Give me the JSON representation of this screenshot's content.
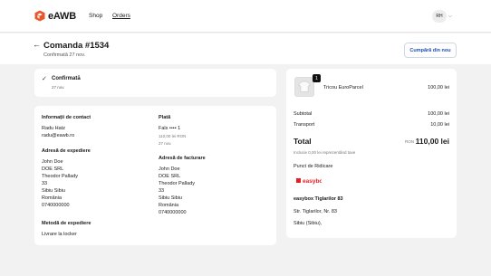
{
  "topbar": {
    "brand": "eAWB",
    "nav": [
      "Shop",
      "Orders"
    ],
    "avatar": "RH",
    "brand_color": "#e8572a"
  },
  "header": {
    "back_icon": "arrow-left-icon",
    "title": "Comanda #1534",
    "subtitle": "Confirmată 27 nov.",
    "buy_again": "Cumpără din nou"
  },
  "status": {
    "label": "Confirmată",
    "date": "27 nov."
  },
  "contact": {
    "heading": "Informații de contact",
    "name": "Radu Hatz",
    "email": "radu@eawb.ro"
  },
  "payment": {
    "heading": "Plată",
    "method": "Fals •••• 1",
    "amount": "110,00 lei RON",
    "date": "27 nov."
  },
  "shipping_address": {
    "heading": "Adresă de expediere",
    "lines": [
      "John Doe",
      "DOE SRL",
      "Theodor Pallady",
      "33",
      "Sibiu Sibiu",
      "România",
      "0740000000"
    ]
  },
  "billing_address": {
    "heading": "Adresă de facturare",
    "lines": [
      "John Doe",
      "DOE SRL",
      "Theodor Pallady",
      "33",
      "Sibiu Sibiu",
      "România",
      "0740000000"
    ]
  },
  "shipping_method": {
    "heading": "Metodă de expediere",
    "value": "Livrare la locker"
  },
  "summary": {
    "product": {
      "name": "Tricou EuroParcel",
      "price": "100,00 lei",
      "qty": "1"
    },
    "subtotal_label": "Subtotal",
    "subtotal": "100,00 lei",
    "transport_label": "Transport",
    "transport": "10,00 lei",
    "total_label": "Total",
    "total_currency": "RON",
    "total": "110,00 lei",
    "tax_note": "Inclusiv 0,00 lei reprezentând taxe",
    "pickup_heading": "Punct de Ridicare",
    "pickup_logo": "easybox",
    "pickup_name": "easybox Tiglarilor 83",
    "pickup_street": "Str. Tiglarilor, Nr. 83",
    "pickup_city": "Sibiu (Sibiu),"
  }
}
